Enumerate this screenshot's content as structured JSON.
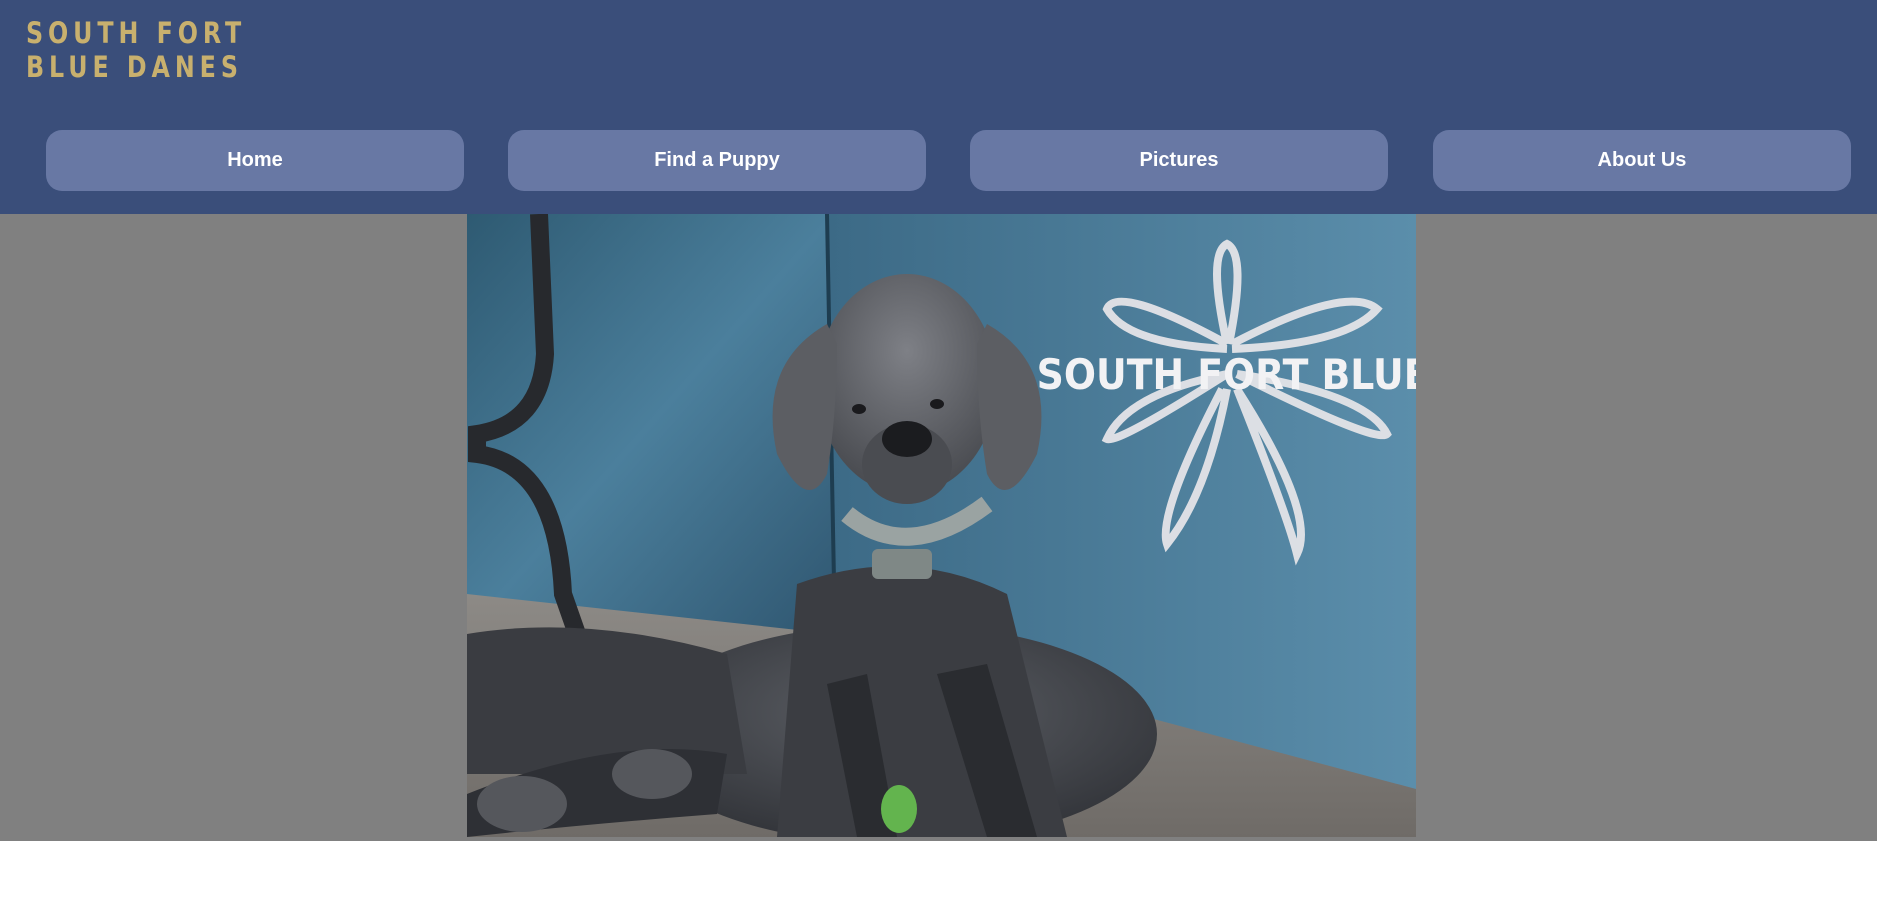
{
  "brand": {
    "line1": "SOUTH FORT",
    "line2": "BLUE DANES",
    "logo_icon": "great-dane-head-icon",
    "text_color": "#c8b06e"
  },
  "nav": {
    "items": [
      {
        "label": "Home"
      },
      {
        "label": "Find a Puppy"
      },
      {
        "label": "Pictures"
      },
      {
        "label": "About Us"
      }
    ]
  },
  "hero": {
    "image_description_icon": "great-dane-photo",
    "watermark": "SOUTH FORT BLUE DANES"
  },
  "colors": {
    "header_bg": "#3a4e7a",
    "nav_button_bg": "#6878a4",
    "hero_bg": "#808080"
  }
}
